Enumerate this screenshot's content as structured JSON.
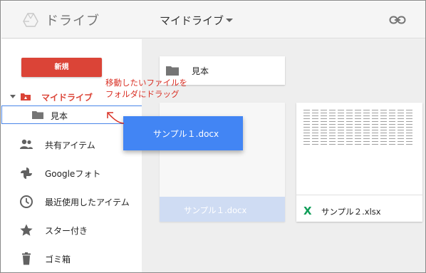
{
  "header": {
    "app_title": "ドライブ",
    "location_title": "マイドライブ",
    "logo_icon": "drive-logo-icon",
    "share_icon": "link-icon"
  },
  "sidebar": {
    "new_button": "新規",
    "tree_root": "マイドライブ",
    "tree_folder": "見本",
    "items": [
      {
        "label": "共有アイテム",
        "icon": "people-icon"
      },
      {
        "label": "Googleフォト",
        "icon": "pinwheel-icon"
      },
      {
        "label": "最近使用したアイテム",
        "icon": "clock-icon"
      },
      {
        "label": "スター付き",
        "icon": "star-icon"
      },
      {
        "label": "ゴミ箱",
        "icon": "trash-icon"
      }
    ]
  },
  "annotation": {
    "line1": "移動したいファイルを",
    "line2": "フォルダにドラッグ"
  },
  "main": {
    "folder": "見本",
    "files": [
      {
        "name": "サンプル１.docx",
        "type": "docx"
      },
      {
        "name": "サンプル２.xlsx",
        "type": "xlsx",
        "type_mark": "X"
      }
    ]
  },
  "drag_ghost": {
    "label": "サンプル１.docx"
  },
  "colors": {
    "accent_red": "#db4437",
    "selection_blue": "#4a86e8",
    "drag_blue": "#4285f4",
    "sheets_green": "#0f9d58"
  }
}
